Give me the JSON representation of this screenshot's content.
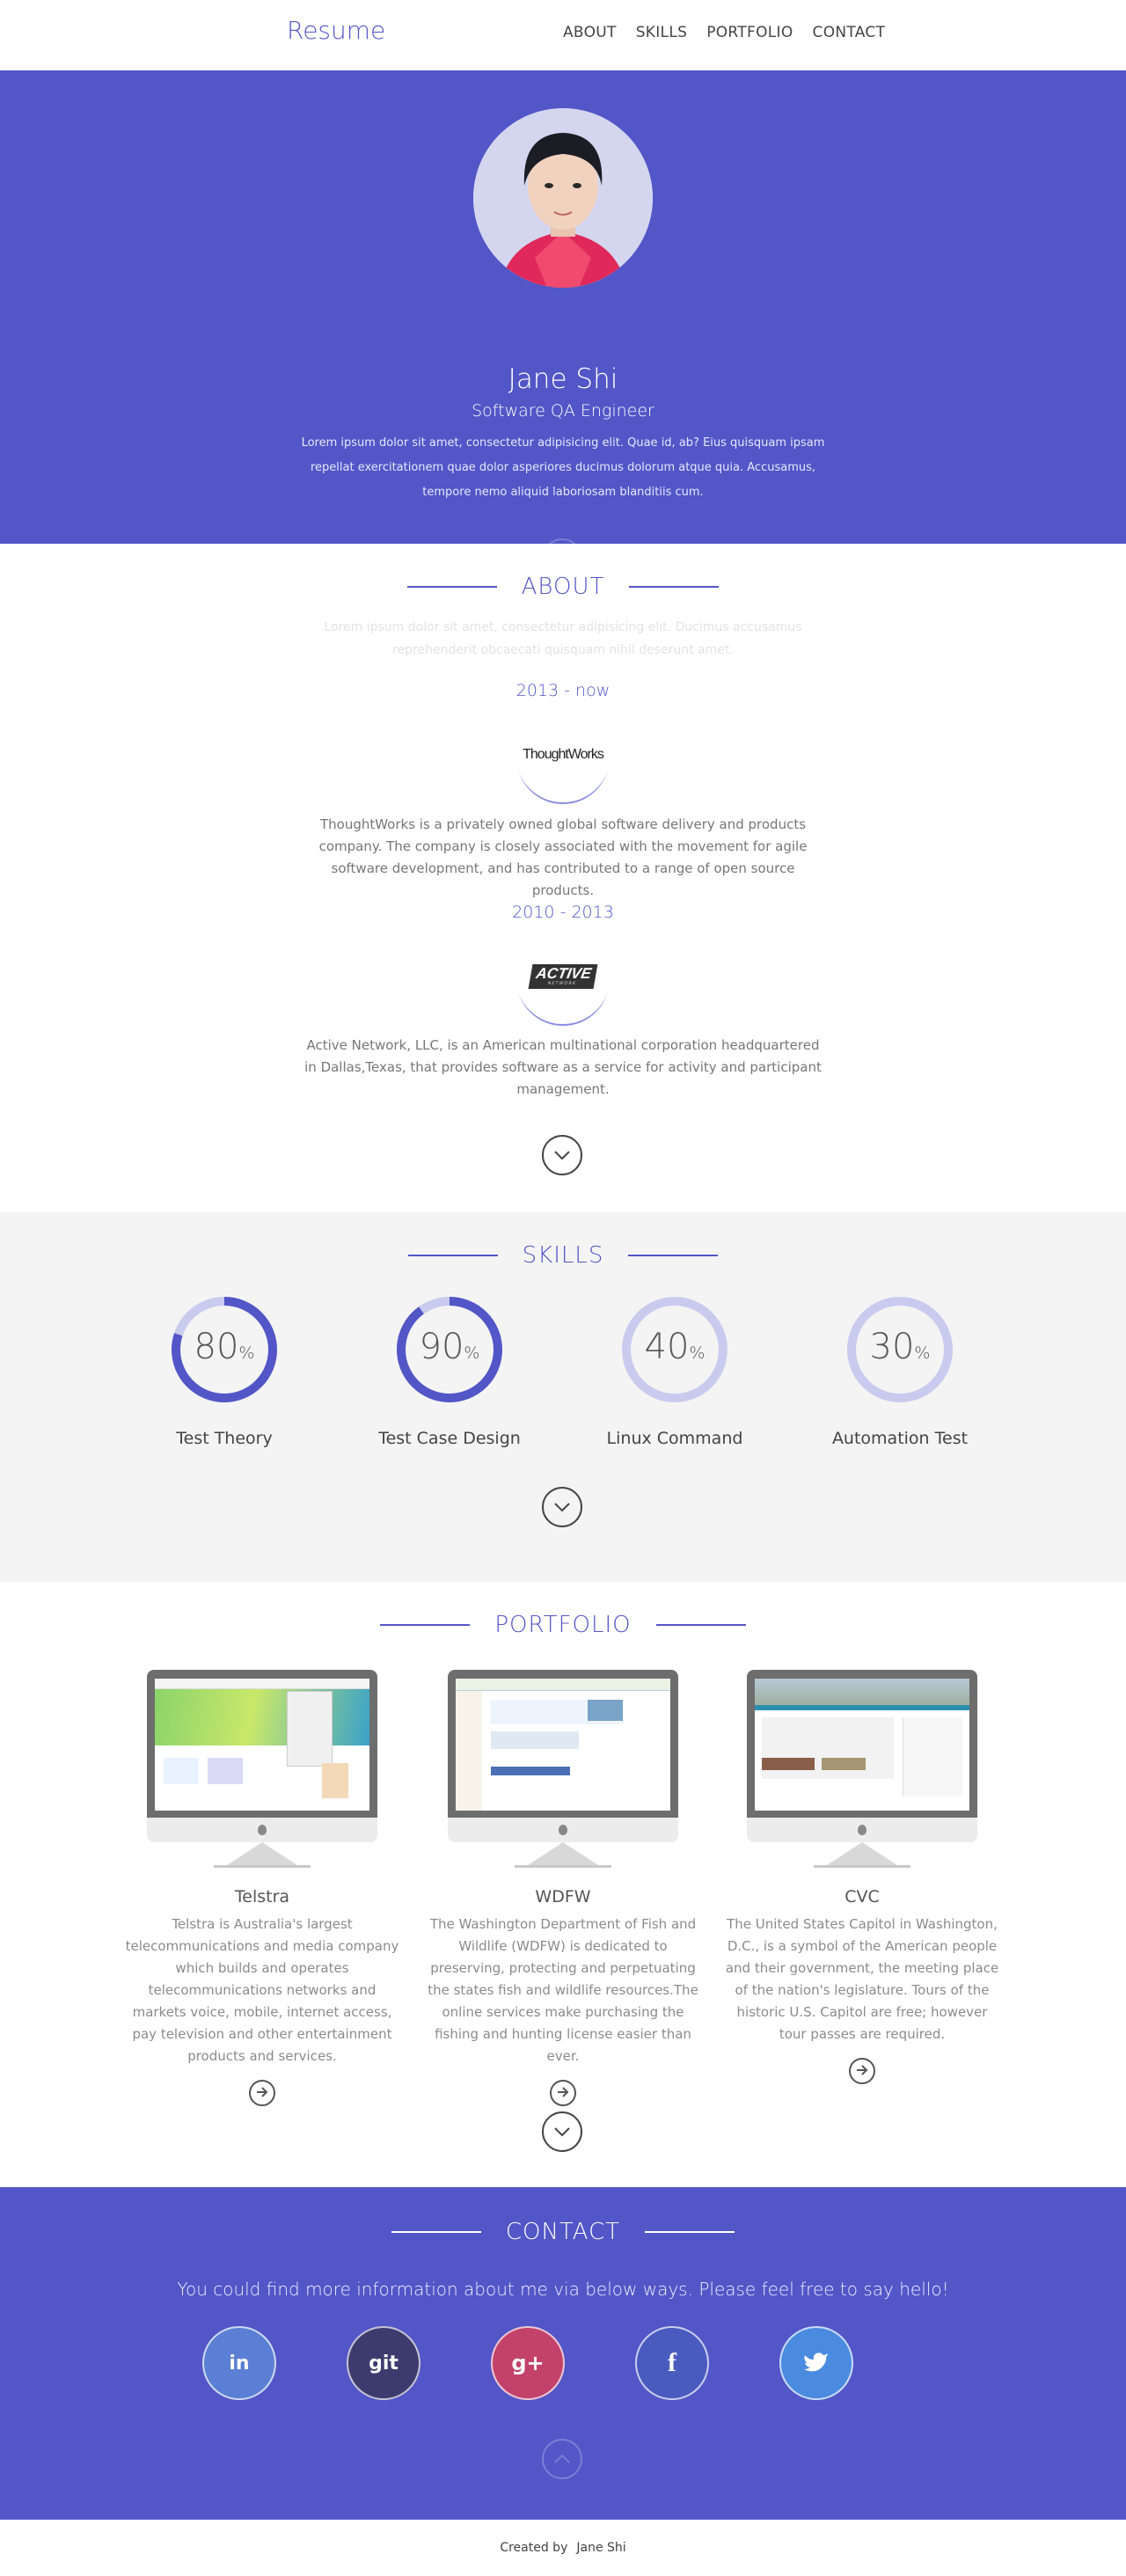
{
  "nav": {
    "brand": "Resume",
    "items": [
      "ABOUT",
      "SKILLS",
      "PORTFOLIO",
      "CONTACT"
    ]
  },
  "hero": {
    "name": "Jane Shi",
    "title": "Software QA Engineer",
    "description": "Lorem ipsum dolor sit amet, consectetur adipisicing elit. Quae id, ab? Eius quisquam ipsam repellat exercitationem quae dolor asperiores ducimus dolorum atque quia. Accusamus, tempore nemo aliquid laboriosam blanditiis cum."
  },
  "about": {
    "title": "ABOUT",
    "subtitle": "Lorem ipsum dolor sit amet, consectetur adipisicing elit. Ducimus accusamus reprehenderit obcaecati quisquam nihil deserunt amet.",
    "jobs": [
      {
        "period": "2013 - now",
        "logo_text": "ThoughtWorks",
        "description": "ThoughtWorks is a privately owned global software delivery and products company. The company is closely associated with the movement for agile software development, and has contributed to a range of open source products."
      },
      {
        "period": "2010 - 2013",
        "logo_text": "ACTIVE",
        "logo_subtext": "NETWORK",
        "description": "Active Network, LLC, is an American multinational corporation headquartered in Dallas,Texas, that provides software as a service for activity and participant management."
      }
    ]
  },
  "skills": {
    "title": "SKILLS",
    "items": [
      {
        "name": "Test Theory",
        "value": "80",
        "percent": 80
      },
      {
        "name": "Test Case Design",
        "value": "90",
        "percent": 90
      },
      {
        "name": "Linux Command",
        "value": "40",
        "percent": 40
      },
      {
        "name": "Automation Test",
        "value": "30",
        "percent": 30
      }
    ],
    "unit": "%"
  },
  "portfolio": {
    "title": "PORTFOLIO",
    "projects": [
      {
        "name": "Telstra",
        "description": "Telstra is Australia's largest telecommunications and media company which builds and operates telecommunications networks and markets voice, mobile, internet access, pay television and other entertainment products and services."
      },
      {
        "name": "WDFW",
        "description": "The Washington Department of Fish and Wildlife (WDFW) is dedicated to preserving, protecting and perpetuating the states fish and wildlife resources.The online services make purchasing the fishing and hunting license easier than ever."
      },
      {
        "name": "CVC",
        "description": "The United States Capitol in Washington, D.C., is a symbol of the American people and their government, the meeting place of the nation's legislature. Tours of the historic U.S. Capitol are free; however tour passes are required."
      }
    ]
  },
  "contact": {
    "title": "CONTACT",
    "message": "You could find more information about me via below ways. Please feel free to say hello!",
    "social": [
      {
        "icon": "linkedin-icon",
        "glyph": "in",
        "color": "#5a7fd4"
      },
      {
        "icon": "github-icon",
        "glyph": "git",
        "color": "#3d3a6e"
      },
      {
        "icon": "google-plus-icon",
        "glyph": "g+",
        "color": "#c2426b"
      },
      {
        "icon": "facebook-icon",
        "glyph": "f",
        "color": "#4a5bc0"
      },
      {
        "icon": "twitter-icon",
        "glyph": "t",
        "color": "#4a8be0"
      }
    ]
  },
  "footer": {
    "created_by": "Created by",
    "author": "Jane Shi"
  },
  "colors": {
    "accent": "#5356c7",
    "skills_bg": "#f4f4f4",
    "ring_track": "#c9cbee",
    "ring_fill": "#5356c7"
  }
}
